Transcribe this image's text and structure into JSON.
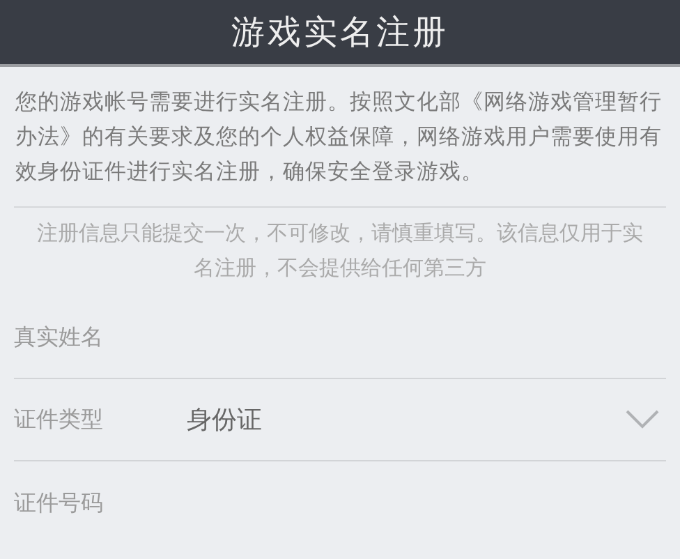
{
  "window": {
    "title": "游戏实名注册"
  },
  "intro": "您的游戏帐号需要进行实名注册。按照文化部《网络游戏管理暂行办法》的有关要求及您的个人权益保障，网络游戏用户需要使用有效身份证件进行实名注册，确保安全登录游戏。",
  "notice": "注册信息只能提交一次，不可修改，请慎重填写。该信息仅用于实名注册，不会提供给任何第三方",
  "fields": [
    {
      "kind": "input",
      "placeholder": "真实姓名"
    },
    {
      "kind": "select",
      "label": "证件类型",
      "value": "身份证"
    },
    {
      "kind": "input",
      "placeholder": "证件号码"
    }
  ]
}
